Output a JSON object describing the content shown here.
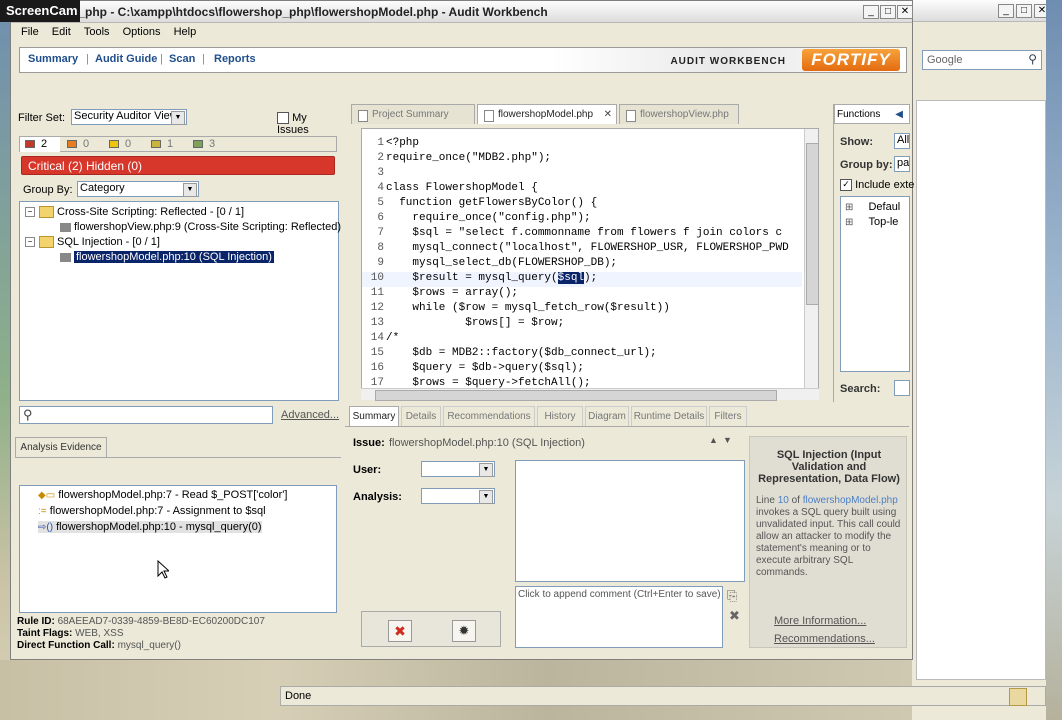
{
  "window": {
    "title": "p_php - C:\\xampp\\htdocs\\flowershop_php\\flowershopModel.php - Audit Workbench",
    "screencam_label": "ScreenCam"
  },
  "menu": [
    "File",
    "Edit",
    "Tools",
    "Options",
    "Help"
  ],
  "nav": {
    "items": [
      "Summary",
      "Audit Guide",
      "Scan",
      "Reports"
    ],
    "product_label": "AUDIT WORKBENCH",
    "logo_text": "FORTIFY"
  },
  "browser": {
    "search_placeholder": "Google",
    "status": "Done"
  },
  "issues_panel": {
    "filter_set_label": "Filter Set:",
    "filter_set_value": "Security Auditor View",
    "my_issues_label": "My Issues",
    "counts": [
      {
        "value": "2",
        "color": "#c0392b"
      },
      {
        "value": "0",
        "color": "#e67e22"
      },
      {
        "value": "0",
        "color": "#f1c40f"
      },
      {
        "value": "1",
        "color": "#c9b53a"
      },
      {
        "value": "3",
        "color": "#7fa05a"
      }
    ],
    "critical_banner": "Critical (2) Hidden (0)",
    "group_by_label": "Group By:",
    "group_by_value": "Category",
    "tree": [
      {
        "label": "Cross-Site Scripting: Reflected - [0 / 1]",
        "child": "flowershopView.php:9 (Cross-Site Scripting: Reflected)"
      },
      {
        "label": "SQL Injection - [0 / 1]",
        "child": "flowershopModel.php:10 (SQL Injection)"
      }
    ],
    "advanced_label": "Advanced..."
  },
  "evidence_panel": {
    "tab": "Analysis Evidence",
    "items": [
      "flowershopModel.php:7 - Read $_POST['color']",
      "flowershopModel.php:7 - Assignment to $sql",
      "flowershopModel.php:10 - mysql_query(0)"
    ],
    "rule_id_label": "Rule ID:",
    "rule_id": "68AEEAD7-0339-4859-BE8D-EC60200DC107",
    "taint_label": "Taint Flags:",
    "taint": "WEB, XSS",
    "direct_label": "Direct Function Call:",
    "direct": "mysql_query()"
  },
  "editor": {
    "tabs": [
      "Project Summary",
      "flowershopModel.php",
      "flowershopView.php"
    ],
    "lines": [
      {
        "n": "1",
        "t": "<?php"
      },
      {
        "n": "2",
        "t": "require_once(\"MDB2.php\");"
      },
      {
        "n": "3",
        "t": ""
      },
      {
        "n": "4",
        "t": "class FlowershopModel {"
      },
      {
        "n": "5",
        "t": "  function getFlowersByColor() {"
      },
      {
        "n": "6",
        "t": "    require_once(\"config.php\");"
      },
      {
        "n": "7",
        "t": "    $sql = \"select f.commonname from flowers f join colors c"
      },
      {
        "n": "8",
        "t": "    mysql_connect(\"localhost\", FLOWERSHOP_USR, FLOWERSHOP_PWD"
      },
      {
        "n": "9",
        "t": "    mysql_select_db(FLOWERSHOP_DB);"
      },
      {
        "n": "10",
        "t": "    $result = mysql_query($sql);"
      },
      {
        "n": "11",
        "t": "    $rows = array();"
      },
      {
        "n": "12",
        "t": "    while ($row = mysql_fetch_row($result))"
      },
      {
        "n": "13",
        "t": "            $rows[] = $row;"
      },
      {
        "n": "14",
        "t": "/*"
      },
      {
        "n": "15",
        "t": "    $db = MDB2::factory($db_connect_url);"
      },
      {
        "n": "16",
        "t": "    $query = $db->query($sql);"
      },
      {
        "n": "17",
        "t": "    $rows = $query->fetchAll();"
      }
    ]
  },
  "functions_panel": {
    "tab": "Functions",
    "show_label": "Show:",
    "show_value": "All",
    "group_label": "Group by:",
    "group_value": "pac",
    "include_label": "Include exte",
    "tree": [
      "Defaul",
      "Top-le"
    ],
    "search_label": "Search:"
  },
  "details": {
    "tabs": [
      "Summary",
      "Details",
      "Recommendations",
      "History",
      "Diagram",
      "Runtime Details",
      "Filters"
    ],
    "issue_label": "Issue:",
    "issue_value": "flowershopModel.php:10 (SQL Injection)",
    "user_label": "User:",
    "analysis_label": "Analysis:",
    "comment_placeholder": "Click to append comment (Ctrl+Enter to save)",
    "sidebar_title": "SQL Injection (Input Validation and Representation, Data Flow)",
    "desc_prefix": "Line",
    "desc_line": "10",
    "desc_of": "of",
    "desc_file": "flowershopModel.php",
    "desc_body": "invokes a SQL query built using unvalidated input. This call could allow an attacker to modify the statement's meaning or to execute arbitrary SQL commands.",
    "more_info": "More Information...",
    "recommendations": "Recommendations..."
  }
}
